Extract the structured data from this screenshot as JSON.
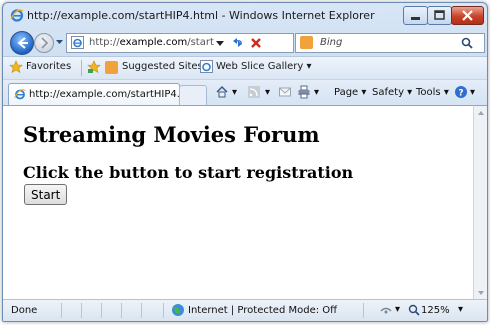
{
  "window": {
    "title": "http://example.com/startHIP4.html - Windows Internet Explorer"
  },
  "address_bar": {
    "url_prefix": "http://",
    "url_domain": "example.com",
    "url_path": "/start"
  },
  "search": {
    "placeholder": "Bing"
  },
  "favorites_bar": {
    "favorites_label": "Favorites",
    "items": [
      {
        "label": "Suggested Sites ▾"
      },
      {
        "label": "Web Slice Gallery ▾"
      }
    ]
  },
  "tabs": [
    {
      "label": "http://example.com/startHIP4.ht..."
    }
  ],
  "command_bar": {
    "page": "Page ▾",
    "safety": "Safety ▾",
    "tools": "Tools ▾"
  },
  "page": {
    "heading": "Streaming Movies Forum",
    "subheading": "Click the button to start registration",
    "start_button": "Start"
  },
  "status_bar": {
    "status": "Done",
    "zone": "Internet | Protected Mode: Off",
    "zoom": "125%"
  },
  "colors": {
    "title_bar": "#c4d8ef",
    "close_button": "#c7432a",
    "back_button": "#1e63c6"
  }
}
